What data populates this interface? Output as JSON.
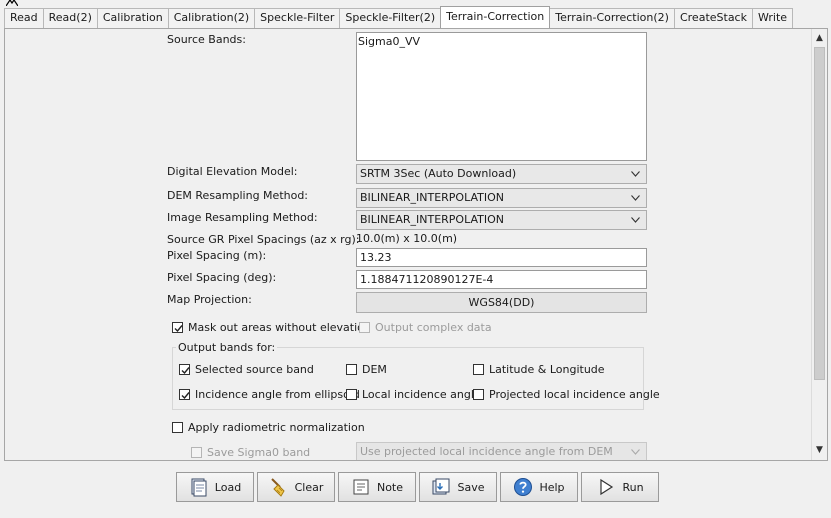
{
  "tabs": [
    "Read",
    "Read(2)",
    "Calibration",
    "Calibration(2)",
    "Speckle-Filter",
    "Speckle-Filter(2)",
    "Terrain-Correction",
    "Terrain-Correction(2)",
    "CreateStack",
    "Write"
  ],
  "active_tab": "Terrain-Correction",
  "form": {
    "source_bands_label": "Source Bands:",
    "source_bands": [
      "Sigma0_VV"
    ],
    "dem_label": "Digital Elevation Model:",
    "dem_value": "SRTM 3Sec (Auto Download)",
    "dem_resampling_label": "DEM Resampling Method:",
    "dem_resampling_value": "BILINEAR_INTERPOLATION",
    "image_resampling_label": "Image Resampling Method:",
    "image_resampling_value": "BILINEAR_INTERPOLATION",
    "gr_spacing_label": "Source GR Pixel Spacings (az x rg):",
    "gr_spacing_value": "10.0(m) x 10.0(m)",
    "pixel_spacing_m_label": "Pixel Spacing (m):",
    "pixel_spacing_m_value": "13.23",
    "pixel_spacing_deg_label": "Pixel Spacing (deg):",
    "pixel_spacing_deg_value": "1.188471120890127E-4",
    "map_projection_label": "Map Projection:",
    "map_projection_value": "WGS84(DD)",
    "mask_label": "Mask out areas without elevation",
    "mask_checked": true,
    "complex_label": "Output complex data",
    "complex_checked": false,
    "output_bands_title": "Output bands for:",
    "selected_source_band_label": "Selected source band",
    "selected_source_band_checked": true,
    "dem_band_label": "DEM",
    "dem_band_checked": false,
    "latlon_label": "Latitude & Longitude",
    "latlon_checked": false,
    "incidence_ellipsoid_label": "Incidence angle from ellipsoid",
    "incidence_ellipsoid_checked": true,
    "local_incidence_label": "Local incidence angle",
    "local_incidence_checked": false,
    "projected_local_incidence_label": "Projected local incidence angle",
    "projected_local_incidence_checked": false,
    "radiometric_label": "Apply radiometric normalization",
    "radiometric_checked": false,
    "save_sigma0_label": "Save Sigma0 band",
    "save_sigma0_checked": false,
    "sigma0_option_value": "Use projected local incidence angle from DEM"
  },
  "buttons": {
    "load": "Load",
    "clear": "Clear",
    "note": "Note",
    "save": "Save",
    "help": "Help",
    "run": "Run"
  }
}
